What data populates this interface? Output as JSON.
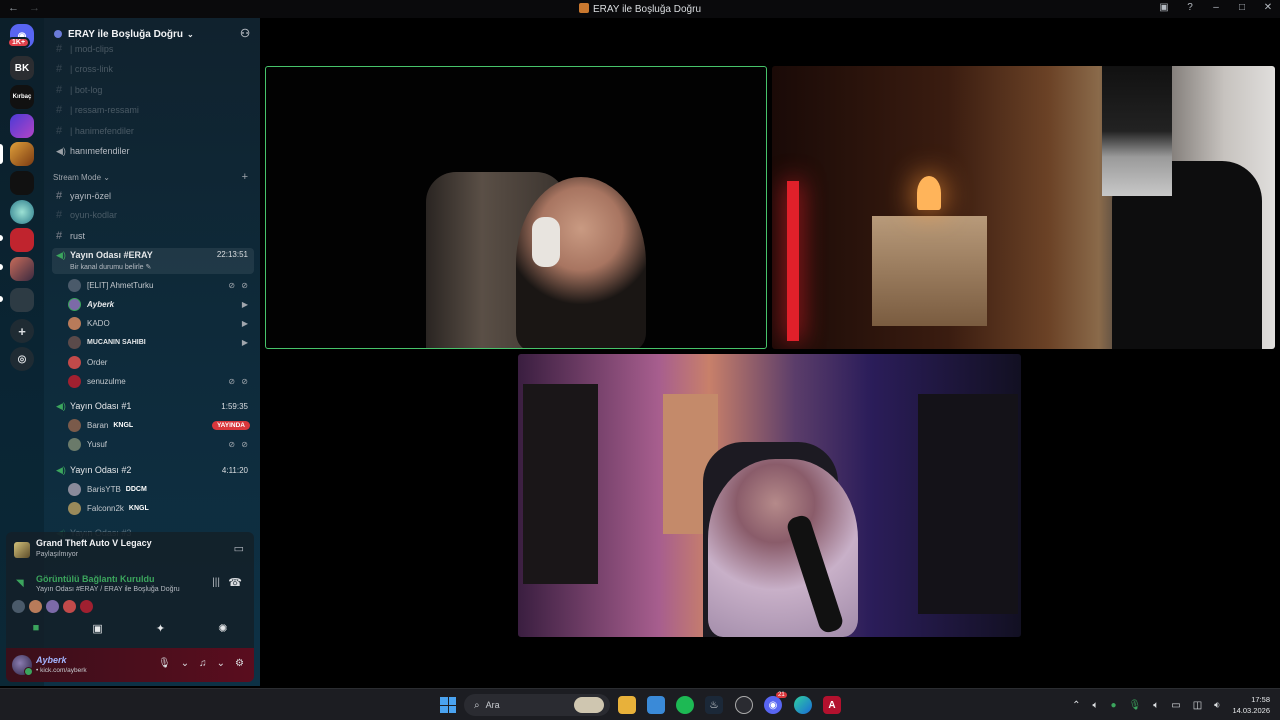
{
  "window": {
    "title": "ERAY ile Boşluğa Doğru",
    "nav_back": "←",
    "nav_forward": "→"
  },
  "rail": {
    "home_badge": "1K+",
    "servers": [
      {
        "label": "BK"
      },
      {
        "label": "Kırbaç"
      }
    ]
  },
  "server": {
    "name": "ERAY ile Boşluğa Doğru",
    "chevron": "⌄",
    "invite_icon": "add-member-icon"
  },
  "channels": {
    "faded_text": [
      {
        "label": "| mod-clips"
      },
      {
        "label": "| cross-link"
      },
      {
        "label": "| bot-log"
      },
      {
        "label": "| ressam-ressami"
      },
      {
        "label": "| hanimefendiler"
      }
    ],
    "voice_top": {
      "label": "hanımefendiler"
    },
    "category": {
      "label": "Stream Mode",
      "add": "+"
    },
    "text": [
      {
        "label": "yayın-özel"
      },
      {
        "label": "oyun-kodlar"
      },
      {
        "label": "rust"
      }
    ],
    "room_main": {
      "label": "Yayın Odası #ERAY",
      "time": "22:13:51",
      "status": "Bir kanal durumu belirle ✎"
    },
    "room_main_users": [
      {
        "name": "[ELIT] AhmetTurku",
        "icons": "⊘ ⊘"
      },
      {
        "name": "Ayberk",
        "icons": "▶"
      },
      {
        "name": "KADO",
        "icons": "▶"
      },
      {
        "name": "MUCANIN SAHIBI",
        "icons": "▶"
      },
      {
        "name": "Order",
        "icons": ""
      },
      {
        "name": "senuzulme",
        "icons": "⊘ ⊘"
      }
    ],
    "room1": {
      "label": "Yayın Odası #1",
      "time": "1:59:35"
    },
    "room1_users": [
      {
        "name": "Baran",
        "tag": "KNGL",
        "live": "YAYINDA"
      },
      {
        "name": "Yusuf",
        "icons": "⊘ ⊘"
      }
    ],
    "room2": {
      "label": "Yayın Odası #2",
      "time": "4:11:20"
    },
    "room2_users": [
      {
        "name": "BarisYTB",
        "tag": "DDCM"
      },
      {
        "name": "Falconn2k",
        "tag": "KNGL"
      }
    ],
    "room3_partial": {
      "label": "Yayın Odası #3"
    }
  },
  "activity": {
    "title": "Grand Theft Auto V Legacy",
    "subtitle": "Paylaşılmıyor"
  },
  "voice": {
    "title": "Görüntülü Bağlantı Kuruldu",
    "subtitle": "Yayın Odası #ERAY / ERAY ile Boşluğa Doğru"
  },
  "account": {
    "name": "Ayberk",
    "status": "• kick.com/ayberk"
  },
  "taskbar": {
    "search": "Ara",
    "time": "17:58",
    "date": "14.03.2026",
    "discord_badge": "21"
  },
  "colors": {
    "accent_green": "#3ba55d",
    "live_red": "#da373c",
    "speaking_border": "#47c36a"
  }
}
